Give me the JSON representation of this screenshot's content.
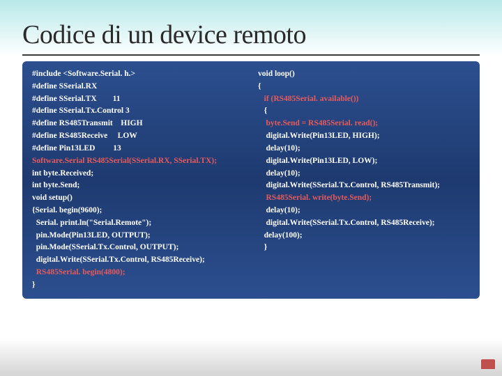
{
  "slide": {
    "title": "Codice di un device remoto",
    "code_left": [
      {
        "t": "#include <Software.Serial. h.>",
        "c": "white"
      },
      {
        "t": "#define SSerial.RX",
        "c": "white"
      },
      {
        "t": "#define SSerial.TX        11",
        "c": "white"
      },
      {
        "t": "#define SSerial.Tx.Control 3",
        "c": "white"
      },
      {
        "t": "#define RS485Transmit    HIGH",
        "c": "white"
      },
      {
        "t": "#define RS485Receive     LOW",
        "c": "white"
      },
      {
        "t": "#define Pin13LED         13",
        "c": "white"
      },
      {
        "t": "Software.Serial RS485Serial(SSerial.RX, SSerial.TX);",
        "c": "red"
      },
      {
        "t": "int byte.Received;",
        "c": "white"
      },
      {
        "t": "int byte.Send;",
        "c": "white"
      },
      {
        "t": "void setup()",
        "c": "white"
      },
      {
        "t": "{Serial. begin(9600);",
        "c": "white"
      },
      {
        "t": "  Serial. print.ln(\"Serial.Remote\");",
        "c": "white"
      },
      {
        "t": "  pin.Mode(Pin13LED, OUTPUT);",
        "c": "white"
      },
      {
        "t": "  pin.Mode(SSerial.Tx.Control, OUTPUT);",
        "c": "white"
      },
      {
        "t": "  digital.Write(SSerial.Tx.Control, RS485Receive);",
        "c": "white"
      },
      {
        "t": "  RS485Serial. begin(4800);",
        "c": "red"
      },
      {
        "t": "}",
        "c": "white"
      }
    ],
    "code_right": [
      {
        "t": "void loop()",
        "c": "white"
      },
      {
        "t": "{",
        "c": "white"
      },
      {
        "t": "   if (RS485Serial. available())",
        "c": "red"
      },
      {
        "t": "   {",
        "c": "white"
      },
      {
        "t": "    byte.Send = RS485Serial. read();",
        "c": "red"
      },
      {
        "t": "    digital.Write(Pin13LED, HIGH);",
        "c": "white"
      },
      {
        "t": "    delay(10);",
        "c": "white"
      },
      {
        "t": "    digital.Write(Pin13LED, LOW);",
        "c": "white"
      },
      {
        "t": "    delay(10);",
        "c": "white"
      },
      {
        "t": "    digital.Write(SSerial.Tx.Control, RS485Transmit);",
        "c": "white"
      },
      {
        "t": "    RS485Serial. write(byte.Send);",
        "c": "red"
      },
      {
        "t": "    delay(10);",
        "c": "white"
      },
      {
        "t": "    digital.Write(SSerial.Tx.Control, RS485Receive);",
        "c": "white"
      },
      {
        "t": "   delay(100);",
        "c": "white"
      },
      {
        "t": "   }",
        "c": "white"
      }
    ]
  }
}
